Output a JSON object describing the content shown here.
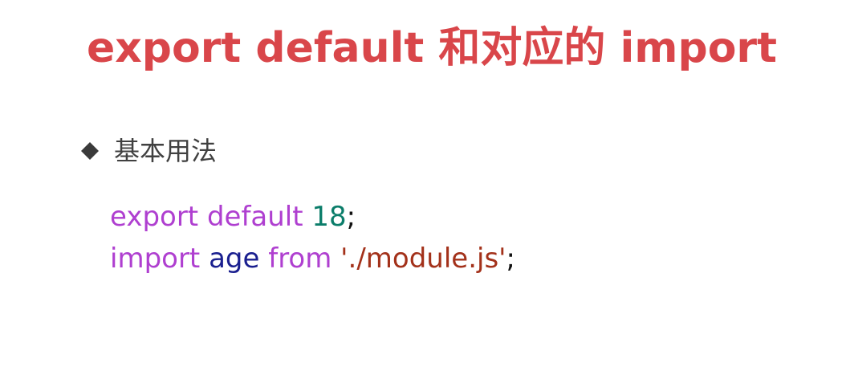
{
  "title": "export default 和对应的 import",
  "bullet": {
    "icon": "diamond-bullet-icon",
    "text": "基本用法"
  },
  "code": {
    "line1": {
      "keyword1": "export",
      "keyword2": "default",
      "number": "18",
      "semicolon": ";"
    },
    "line2": {
      "keyword1": "import",
      "identifier": "age",
      "keyword2": "from",
      "string": "'./module.js'",
      "semicolon": ";"
    }
  },
  "colors": {
    "title": "#d9464a",
    "keyword": "#af3fd0",
    "number": "#0b7d6a",
    "identifier": "#1a1f8f",
    "string": "#a3311a",
    "bullet_text": "#404040"
  }
}
